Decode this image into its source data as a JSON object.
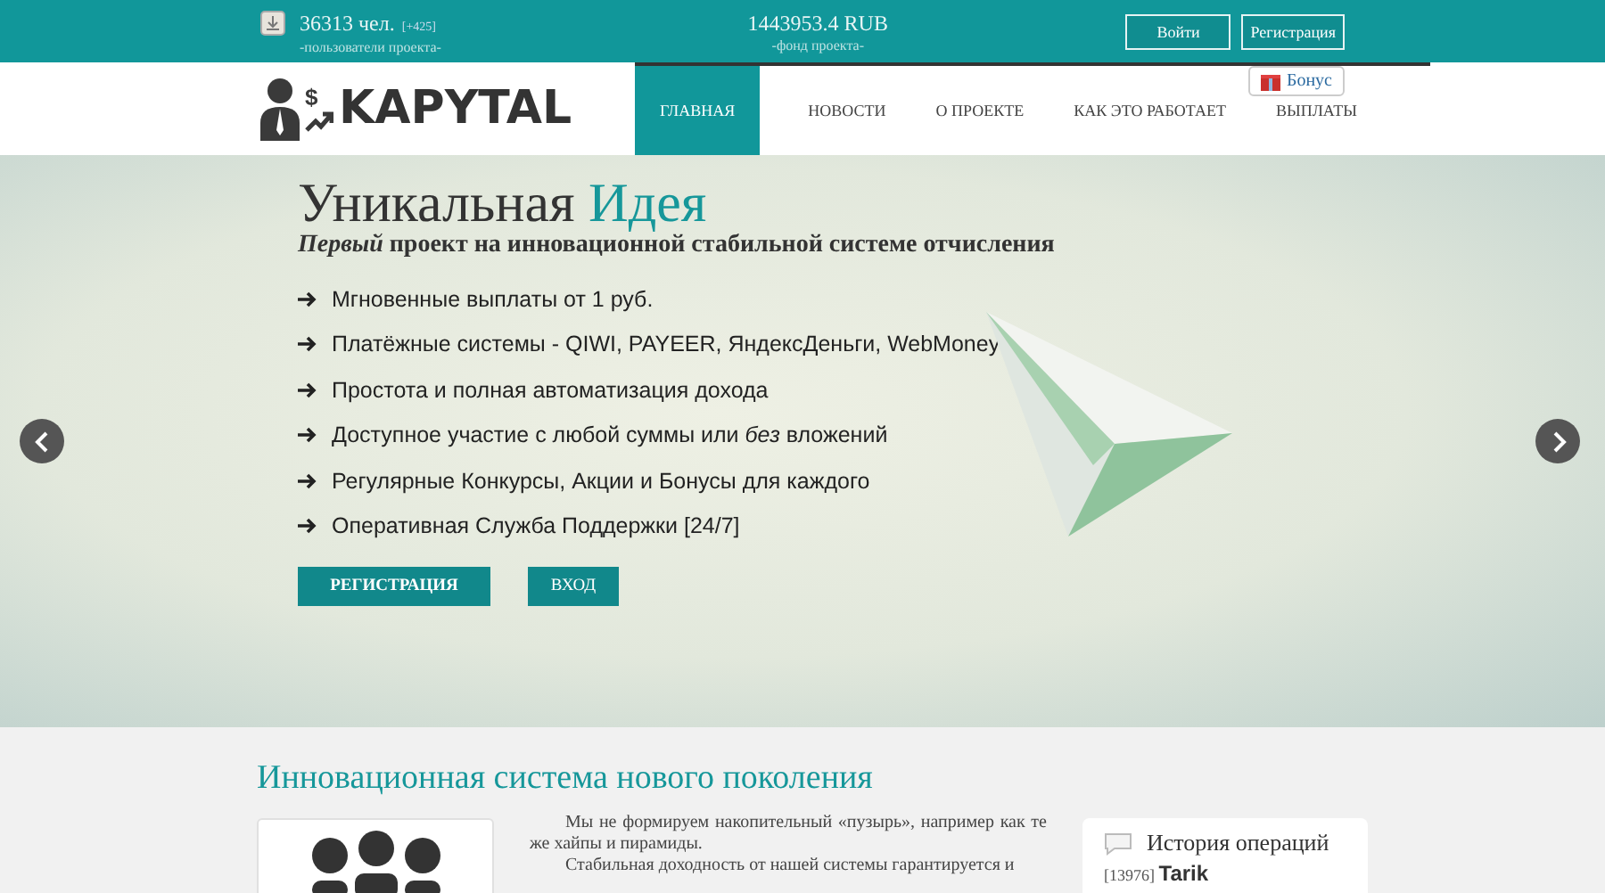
{
  "topbar": {
    "users": {
      "count": "36313 чел.",
      "delta": "[+425]",
      "caption": "-пользователи проекта-"
    },
    "fund": {
      "amount": "1443953.4 RUB",
      "caption": "-фонд проекта-"
    },
    "buttons": [
      "Войти",
      "Регистрация"
    ],
    "bonus": "Бонус"
  },
  "header": {
    "logo_mark": "$",
    "logo": "KAPYTAL",
    "nav": [
      {
        "label": "ГЛАВНАЯ",
        "selected": true
      },
      {
        "label": "НОВОСТИ",
        "selected": false
      },
      {
        "label": "О ПРОЕКТЕ",
        "selected": false
      },
      {
        "label": "КАК ЭТО РАБОТАЕТ",
        "selected": false
      },
      {
        "label": "ВЫПЛАТЫ",
        "selected": false
      }
    ]
  },
  "hero": {
    "title": "Уникальная",
    "title_accent": "Идея",
    "subtitle": "*Первый* проект на инновационной стабильной системе отчисления",
    "features": [
      "Мгновенные выплаты от 1 руб.",
      "Платёжные системы - QIWI, PAYEER, ЯндексДеньги, WebMoney",
      "Простота и полная автоматизация дохода",
      "Доступное участие с любой суммы или *без* вложений",
      "Регулярные Конкурсы, Акции и Бонусы для каждого",
      "Оперативная Служба Поддержки [24/7]"
    ],
    "buttons": [
      "РЕГИСТРАЦИЯ",
      "ВХОД"
    ]
  },
  "section": {
    "title": "Инновационная система нового поколения",
    "paragraphs": [
      "Мы не формируем накопительный «пузырь», например как те же хайпы и пирамиды.",
      "Стабильная доходность от нашей системы гарантируется и"
    ]
  },
  "history": {
    "title": "История операций",
    "entry": {
      "id": "[13976]",
      "name": "Tarik"
    }
  }
}
